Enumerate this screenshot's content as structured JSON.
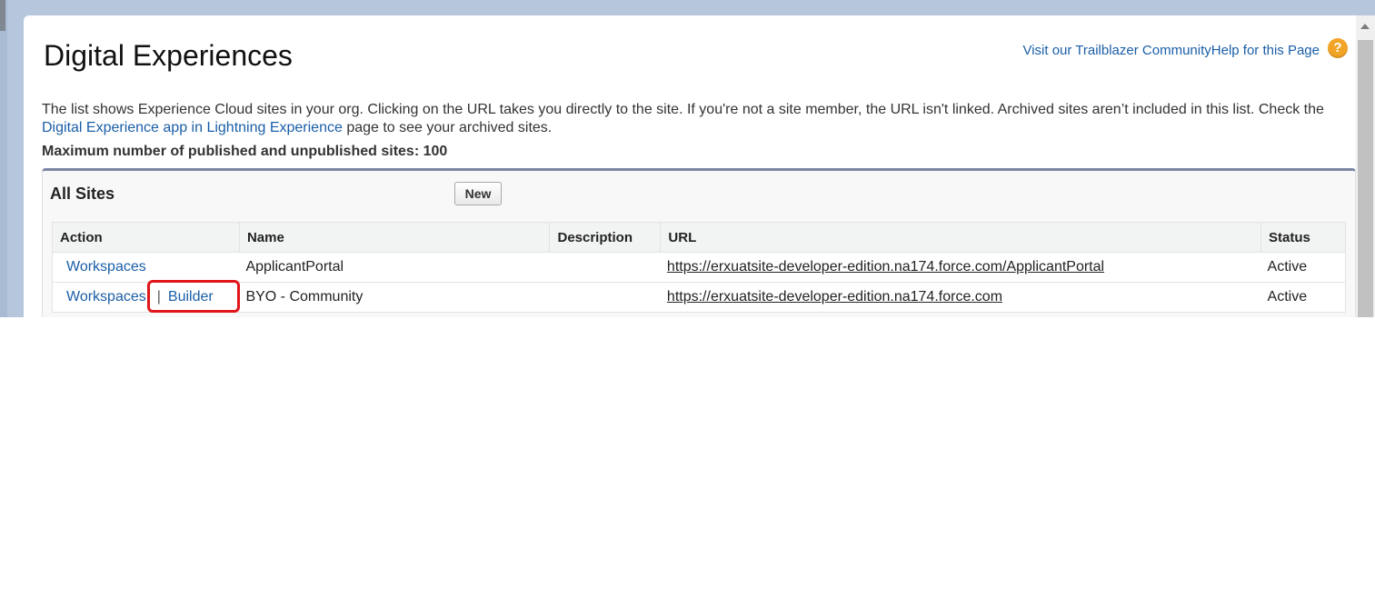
{
  "page": {
    "title": "Digital Experiences",
    "top_links": {
      "trailblazer": "Visit our Trailblazer Community",
      "help": "Help for this Page",
      "help_icon": "?"
    },
    "intro": {
      "text_1": "The list shows Experience Cloud sites in your org. Clicking on the URL takes you directly to the site. If you're not a site member, the URL isn't linked. Archived sites aren’t included in this list. Check the ",
      "link": "Digital Experience app in Lightning Experience",
      "text_2": " page to see your archived sites."
    },
    "max_sites": "Maximum number of published and unpublished sites: 100"
  },
  "panel": {
    "title": "All Sites",
    "new_button": "New",
    "columns": {
      "action": "Action",
      "name": "Name",
      "description": "Description",
      "url": "URL",
      "status": "Status"
    },
    "rows": [
      {
        "workspaces": "Workspaces",
        "name": "ApplicantPortal",
        "description": "",
        "url": "https://erxuatsite-developer-edition.na174.force.com/ApplicantPortal",
        "status": "Active"
      },
      {
        "workspaces": "Workspaces",
        "separator": "|",
        "builder": "Builder",
        "name": "BYO - Community",
        "description": "",
        "url": "https://erxuatsite-developer-edition.na174.force.com",
        "status": "Active"
      }
    ]
  },
  "colors": {
    "link": "#1a5ea8",
    "panel_accent": "#7d86a3",
    "help_icon": "#f2a427",
    "highlight": "#e0161b",
    "backdrop": "#b6c6dc"
  }
}
